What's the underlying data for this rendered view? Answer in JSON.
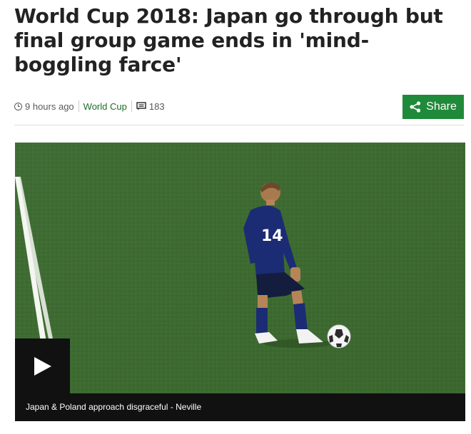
{
  "article": {
    "headline": "World Cup 2018: Japan go through but final group game ends in 'mind-boggling farce'"
  },
  "meta": {
    "time_ago": "9 hours ago",
    "section": "World Cup",
    "comments_count": "183",
    "icons": [
      "clock-icon",
      "comments-icon"
    ]
  },
  "share": {
    "label": "Share",
    "icon": "share-icon",
    "color": "#1f8a3a"
  },
  "media": {
    "caption": "Japan & Poland approach disgraceful - Neville",
    "play_icon": "play-icon",
    "jersey_number": "14"
  },
  "colors": {
    "section_link": "#1b6f28",
    "media_bar": "#111111",
    "pitch": "#3f6b2f"
  }
}
